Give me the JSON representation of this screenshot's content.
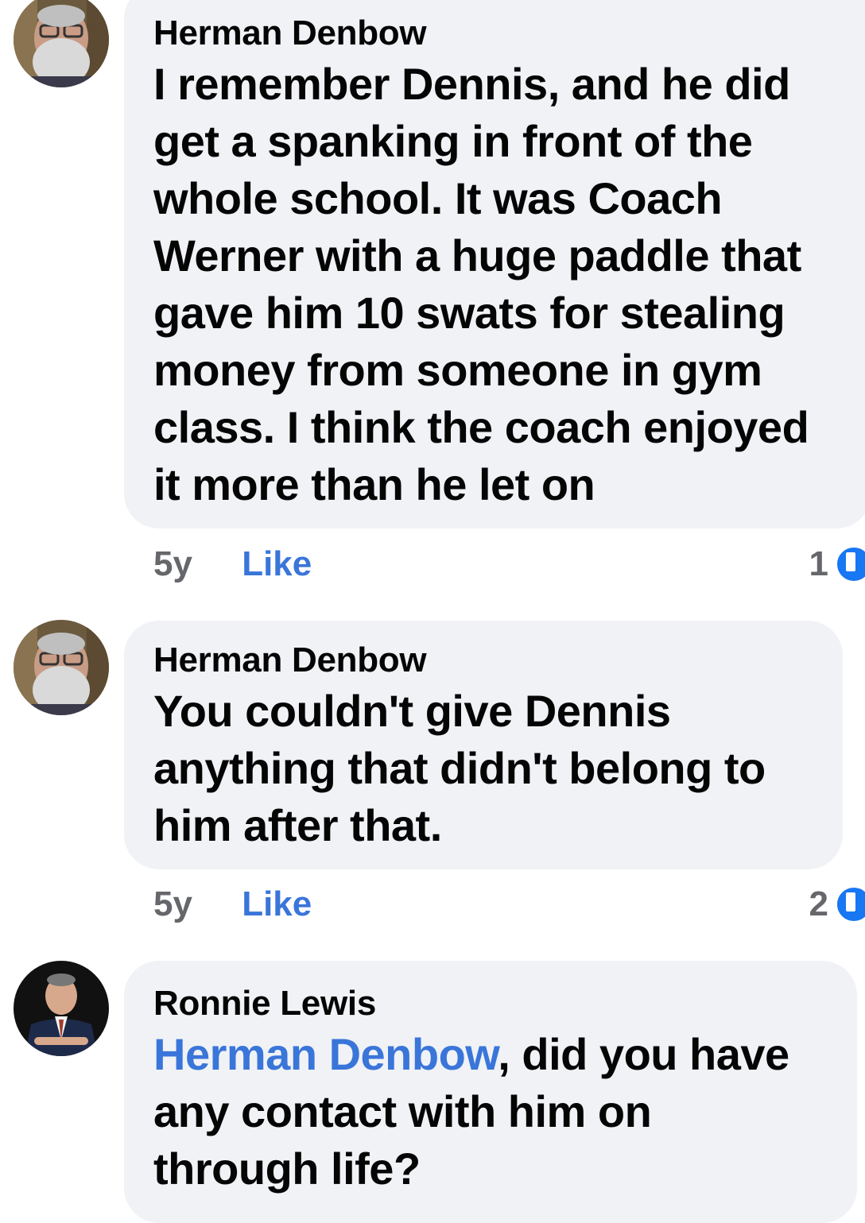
{
  "comments": [
    {
      "author": "Herman Denbow",
      "avatar_icon": "avatar-bearded-man-glasses",
      "lines": [
        "I remember Dennis, and he did",
        "get a spanking in front of the",
        "whole school. It was Coach",
        "Werner with a huge paddle that",
        "gave him 10 swats for stealing",
        "money from someone in gym",
        "class. I think the coach enjoyed",
        "it more than he let on"
      ],
      "time": "5y",
      "like_label": "Like",
      "reaction_count": "1",
      "reaction_icon": "like-thumb-icon"
    },
    {
      "author": "Herman Denbow",
      "avatar_icon": "avatar-bearded-man-glasses",
      "lines": [
        "You couldn't give Dennis",
        "anything that didn't belong to",
        "him after that."
      ],
      "time": "5y",
      "like_label": "Like",
      "reaction_count": "2",
      "reaction_icon": "like-thumb-icon"
    },
    {
      "author": "Ronnie Lewis",
      "avatar_icon": "avatar-man-suit",
      "mention": "Herman Denbow",
      "first_line_rest": ", did you have",
      "lines": [
        "any contact with him on",
        "through life?"
      ]
    }
  ],
  "colors": {
    "bubble": "#f0f2f5",
    "link": "#3a75d9",
    "meta": "#65676b",
    "like_icon": "#1877f2"
  }
}
